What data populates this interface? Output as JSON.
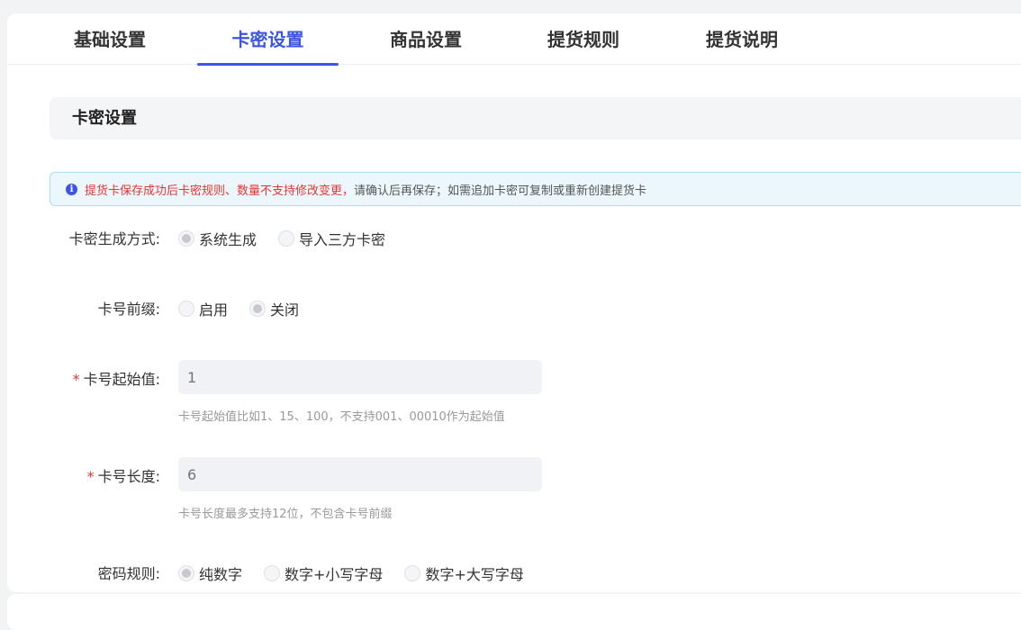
{
  "tabs": [
    {
      "label": "基础设置"
    },
    {
      "label": "卡密设置"
    },
    {
      "label": "商品设置"
    },
    {
      "label": "提货规则"
    },
    {
      "label": "提货说明"
    }
  ],
  "active_tab": "卡密设置",
  "section": {
    "title": "卡密设置"
  },
  "alert": {
    "red_text": "提货卡保存成功后卡密规则、数量不支持修改变更，",
    "rest_text": "请确认后再保存；如需追加卡密可复制或重新创建提货卡"
  },
  "form": {
    "generation": {
      "label": "卡密生成方式:",
      "options": [
        {
          "label": "系统生成",
          "checked": true
        },
        {
          "label": "导入三方卡密",
          "checked": false
        }
      ]
    },
    "prefix": {
      "label": "卡号前缀:",
      "options": [
        {
          "label": "启用",
          "checked": false
        },
        {
          "label": "关闭",
          "checked": true
        }
      ]
    },
    "start_value": {
      "required_mark": "*",
      "label": "卡号起始值:",
      "placeholder": "1",
      "hint": "卡号起始值比如1、15、100，不支持001、00010作为起始值"
    },
    "length": {
      "required_mark": "*",
      "label": "卡号长度:",
      "placeholder": "6",
      "hint": "卡号长度最多支持12位，不包含卡号前缀"
    },
    "password_rule": {
      "label": "密码规则:",
      "options": [
        {
          "label": "纯数字",
          "checked": true
        },
        {
          "label": "数字+小写字母",
          "checked": false
        },
        {
          "label": "数字+大写字母",
          "checked": false
        }
      ]
    }
  },
  "colors": {
    "accent": "#3d55e6",
    "warning": "#e8352f"
  }
}
